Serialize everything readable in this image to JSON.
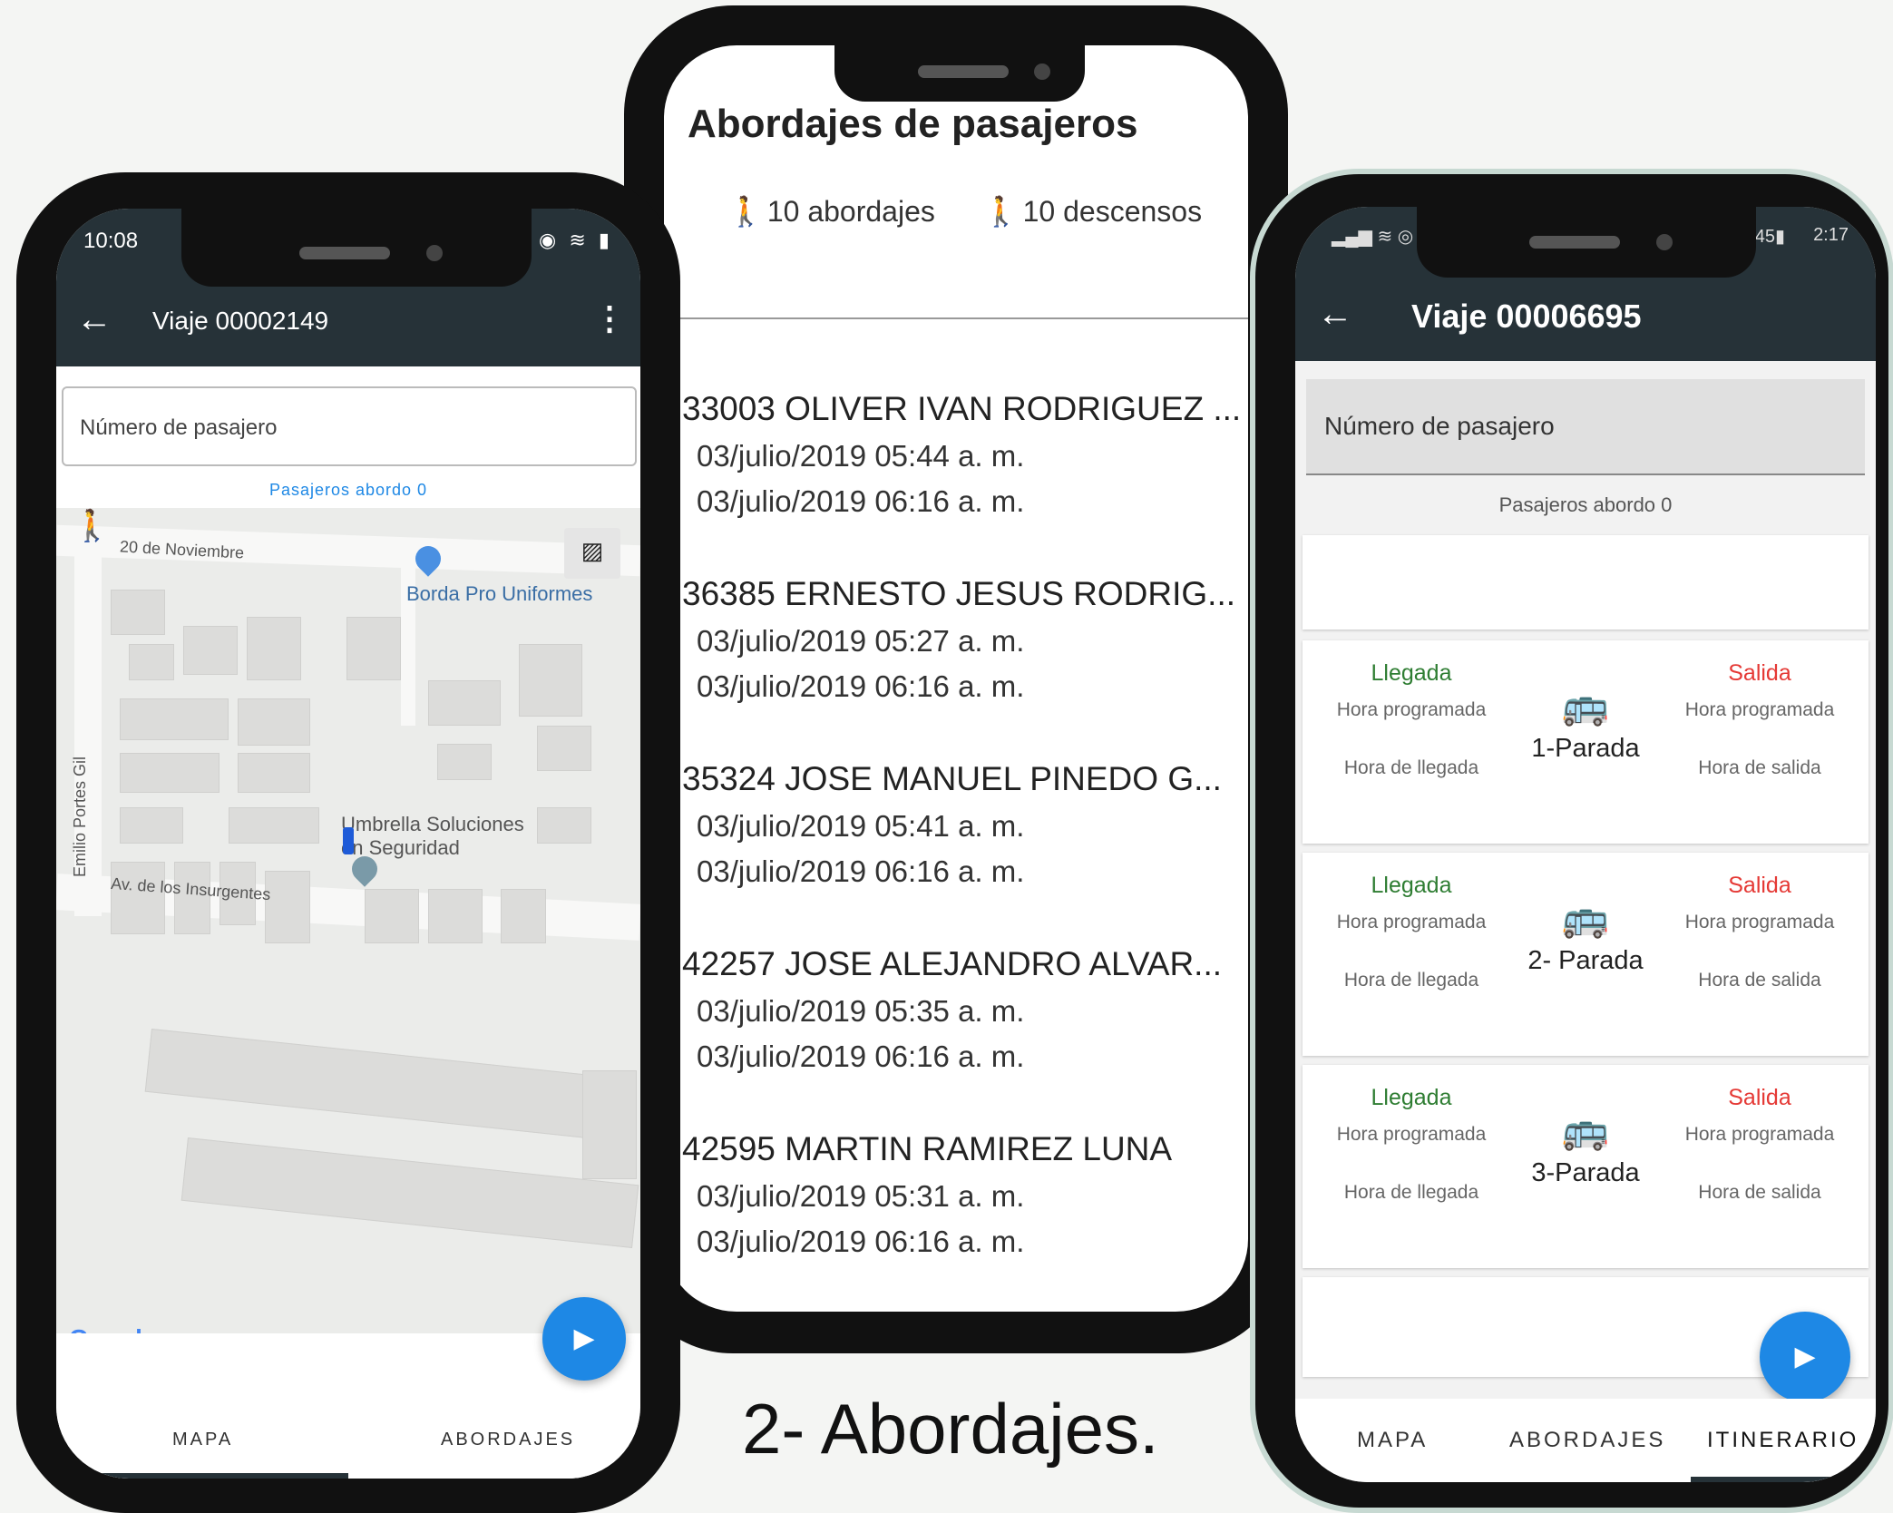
{
  "phone_map": {
    "status_time": "10:08",
    "title": "Viaje 00002149",
    "input_placeholder": "Número de pasajero",
    "aboard_label": "Pasajeros abordo 0",
    "map_labels": {
      "street1": "20 de Noviembre",
      "street2": "Emilio Portes Gil",
      "street3": "Av. de los Insurgentes",
      "poi1": "Borda Pro Uniformes",
      "poi2_line1": "Umbrella Soluciones",
      "poi2_line2": "en Seguridad",
      "google": "Google"
    },
    "tabs": [
      "MAPA",
      "ABORDAJES"
    ]
  },
  "phone_boardings": {
    "title": "Abordajes de pasajeros",
    "boardings": "10 abordajes",
    "alightings": "10 descensos",
    "passengers": [
      {
        "name": "33003 OLIVER IVAN RODRIGUEZ ...",
        "board": "03/julio/2019 05:44 a. m.",
        "alight": "03/julio/2019 06:16 a. m."
      },
      {
        "name": "36385 ERNESTO JESUS RODRIG...",
        "board": "03/julio/2019 05:27 a. m.",
        "alight": "03/julio/2019 06:16 a. m."
      },
      {
        "name": "35324 JOSE MANUEL PINEDO G...",
        "board": "03/julio/2019 05:41 a. m.",
        "alight": "03/julio/2019 06:16 a. m."
      },
      {
        "name": "42257 JOSE ALEJANDRO ALVAR...",
        "board": "03/julio/2019 05:35 a. m.",
        "alight": "03/julio/2019 06:16 a. m."
      },
      {
        "name": "42595 MARTIN RAMIREZ LUNA",
        "board": "03/julio/2019 05:31 a. m.",
        "alight": "03/julio/2019 06:16 a. m."
      }
    ]
  },
  "phone_itinerary": {
    "status_time": "2:17",
    "battery": "45",
    "title": "Viaje 00006695",
    "input_placeholder": "Número de pasajero",
    "aboard_label": "Pasajeros abordo 0",
    "arrival_label": "Llegada",
    "departure_label": "Salida",
    "scheduled_label": "Hora programada",
    "arrival_time_label": "Hora de llegada",
    "departure_time_label": "Hora de salida",
    "stops": [
      "1-Parada",
      "2- Parada",
      "3-Parada"
    ],
    "tabs": [
      "MAPA",
      "ABORDAJES",
      "ITINERARIO"
    ],
    "colors": {
      "arrival": "#2e7d32",
      "departure": "#e53935",
      "appbar": "#263238",
      "fab": "#1e88e5"
    }
  },
  "caption": "2- Abordajes."
}
